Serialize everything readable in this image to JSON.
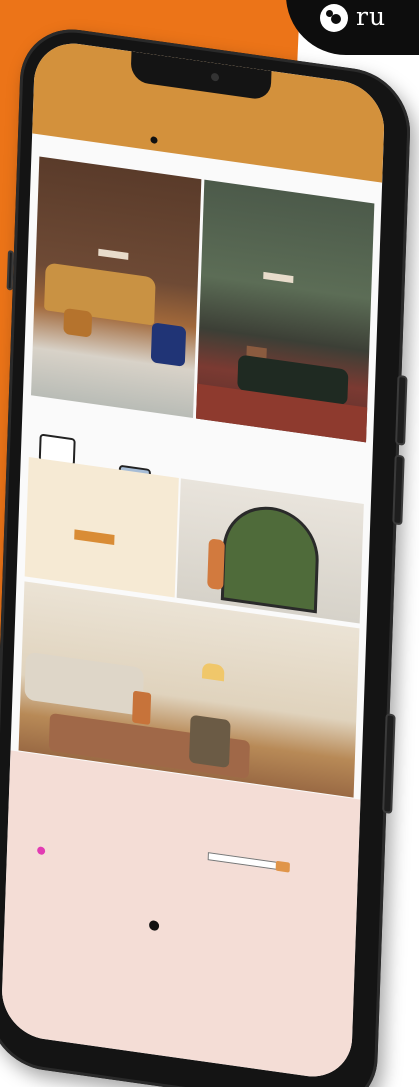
{
  "brand": {
    "corner_text": "ru",
    "accent_color": "#ec7418",
    "dark_color": "#0d0d0d"
  },
  "site": {
    "topband_text": "",
    "logo_text": "",
    "nav_items": [
      "",
      "",
      "",
      "",
      "",
      "",
      ""
    ],
    "hero_left": {
      "title": "",
      "text": "",
      "button": ""
    },
    "hero_right": {
      "title": "",
      "text": "",
      "button": ""
    },
    "categories_title": "",
    "categories": [
      {
        "label": ""
      },
      {
        "label": ""
      },
      {
        "label": ""
      },
      {
        "label": ""
      }
    ],
    "promo": {
      "kicker": "",
      "headline": "",
      "button": ""
    },
    "room": {
      "title": "",
      "text": ""
    },
    "footer": {
      "col1_title": "",
      "col2_title": "",
      "col3_title": "",
      "newsletter_title": "",
      "copyright": ""
    }
  }
}
